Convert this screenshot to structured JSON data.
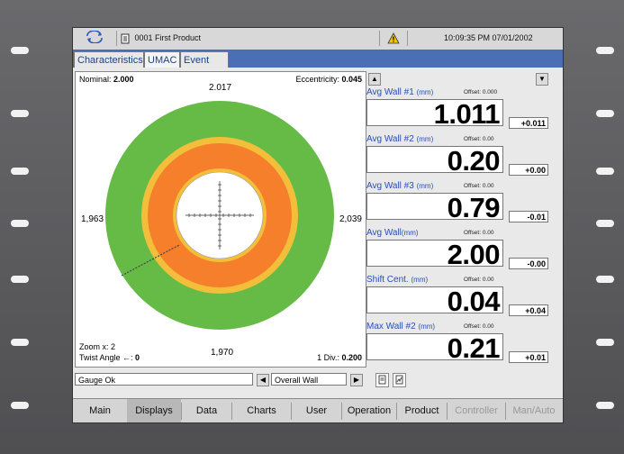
{
  "colors": {
    "outer_ring": "#66bb47",
    "inner_ring": "#f57f2a",
    "band": "#f3bf3a",
    "accent": "#4a6fb5"
  },
  "topbar": {
    "refresh_icon": "refresh-icon",
    "product_icon": "document-icon",
    "product": "0001 First Product",
    "warning_icon": "warning-icon",
    "clock": "10:09:35 PM 07/01/2002"
  },
  "tabs": [
    {
      "label": "Characteristics"
    },
    {
      "label": "UMAC"
    },
    {
      "label": "Event Log"
    }
  ],
  "gauge": {
    "nominal_label": "Nominal:",
    "nominal_value": "2.000",
    "eccentricity_label": "Eccentricity:",
    "eccentricity_value": "0.045",
    "top": "2.017",
    "left": "1,963",
    "right": "2,039",
    "bottom": "1,970",
    "zoom_label": "Zoom x:",
    "zoom_value": "2",
    "twist_label": "Twist Angle ←:",
    "twist_value": "0",
    "div_label": "1 Div.:",
    "div_value": "0.200"
  },
  "measurements": [
    {
      "label": "Avg Wall #1",
      "unit": "(mm)",
      "offset": "Offset: 0.000",
      "value": "1.011",
      "delta": "+0.011"
    },
    {
      "label": "Avg Wall #2",
      "unit": "(mm)",
      "offset": "Offset: 0.00",
      "value": "0.20",
      "delta": "+0.00"
    },
    {
      "label": "Avg Wall #3",
      "unit": "(mm)",
      "offset": "Offset: 0.00",
      "value": "0.79",
      "delta": "-0.01"
    },
    {
      "label": "Avg Wall",
      "unit": "(mm)",
      "offset": "Offset: 0.00",
      "value": "2.00",
      "delta": "-0.00"
    },
    {
      "label": "Shift Cent.",
      "unit": "(mm)",
      "offset": "Offset: 0.00",
      "value": "0.04",
      "delta": "+0.04"
    },
    {
      "label": "Max Wall #2",
      "unit": "(mm)",
      "offset": "Offset: 0.00",
      "value": "0.21",
      "delta": "+0.01"
    }
  ],
  "status": {
    "message": "Gauge Ok",
    "view_select": "Overall Wall"
  },
  "nav": [
    {
      "label": "Main"
    },
    {
      "label": "Displays"
    },
    {
      "label": "Data"
    },
    {
      "label": "Charts"
    },
    {
      "label": "User"
    },
    {
      "label": "Operation"
    },
    {
      "label": "Product"
    },
    {
      "label": "Controller"
    },
    {
      "label": "Man/Auto"
    }
  ]
}
